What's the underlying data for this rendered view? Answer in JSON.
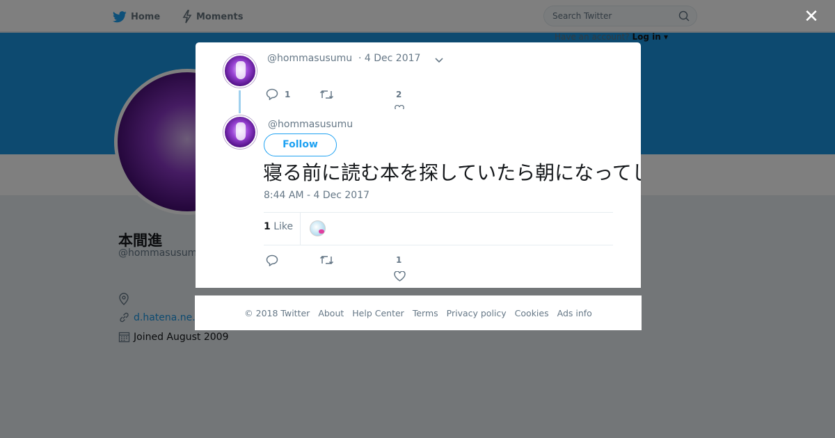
{
  "topbar": {
    "home_label": "Home",
    "moments_label": "Moments",
    "search_placeholder": "Search Twitter",
    "have_account": "Have an account?",
    "login_label": "Log in ▾"
  },
  "profile": {
    "name": "本間進",
    "handle": "@hommasusumu",
    "url": "d.hatena.ne.",
    "joined": "Joined August 2009"
  },
  "modal": {
    "close_label": "✕",
    "parent_tweet": {
      "handle": "@hommasusumu",
      "date": "· 4 Dec 2017",
      "reply_count": "1",
      "like_count": "2"
    },
    "tweet": {
      "handle": "@hommasusumu",
      "follow_label": "Follow",
      "text": "寝る前に読む本を探していたら朝になってしまった。今日も仕事",
      "time": "8:44 AM - 4 Dec 2017",
      "likes_number": "1",
      "likes_label": "Like",
      "like_count": "1"
    }
  },
  "footer": {
    "links": [
      "© 2018 Twitter",
      "About",
      "Help Center",
      "Terms",
      "Privacy policy",
      "Cookies",
      "Ads info"
    ]
  },
  "colors": {
    "brand": "#1da1f2",
    "banner": "#1b95e0",
    "muted_text": "#657786"
  }
}
